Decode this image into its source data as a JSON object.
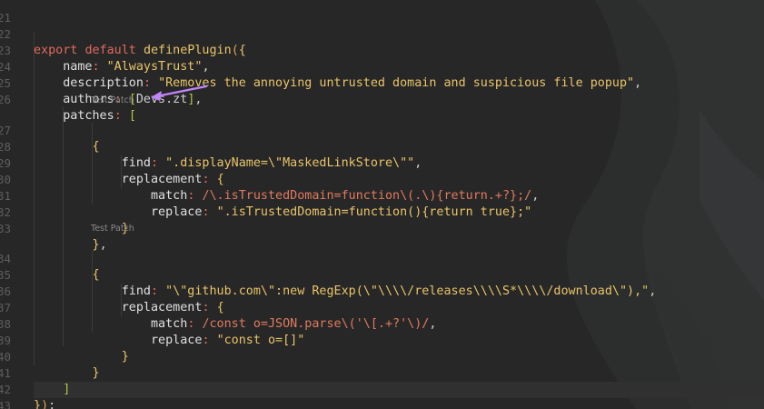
{
  "lines": [
    {
      "n": "21",
      "text": ""
    },
    {
      "n": "22",
      "text": "export default definePlugin({"
    },
    {
      "n": "23",
      "text": "    name: \"AlwaysTrust\","
    },
    {
      "n": "24",
      "text": "    description: \"Removes the annoying untrusted domain and suspicious file popup\","
    },
    {
      "n": "25",
      "text": "    authors: [Devs.zt],"
    },
    {
      "n": "26",
      "text": "    patches: ["
    },
    {
      "n": "27",
      "text": "        {"
    },
    {
      "n": "28",
      "text": "            find: \".displayName=\\\"MaskedLinkStore\\\"\","
    },
    {
      "n": "29",
      "text": "            replacement: {"
    },
    {
      "n": "30",
      "text": "                match: /\\.isTrustedDomain=function\\(.\\){return.+?};/,"
    },
    {
      "n": "31",
      "text": "                replace: \".isTrustedDomain=function(){return true};\""
    },
    {
      "n": "32",
      "text": "            }"
    },
    {
      "n": "33",
      "text": "        },"
    },
    {
      "n": "34",
      "text": "        {"
    },
    {
      "n": "35",
      "text": "            find: \"\\\"github.com\\\":new RegExp(\\\"\\\\\\\\/releases\\\\\\\\S*\\\\\\\\/download\\\"),\","
    },
    {
      "n": "36",
      "text": "            replacement: {"
    },
    {
      "n": "37",
      "text": "                match: /const o=JSON.parse\\('\\[.+?'\\)/,"
    },
    {
      "n": "38",
      "text": "                replace: \"const o=[]\""
    },
    {
      "n": "39",
      "text": "            }"
    },
    {
      "n": "40",
      "text": "        }"
    },
    {
      "n": "41",
      "text": "    ]"
    },
    {
      "n": "42",
      "text": "});"
    },
    {
      "n": "43",
      "text": ""
    }
  ],
  "codelens": {
    "patch1": "Test Patch",
    "patch2": "Test Patch"
  },
  "colors": {
    "background": "#272727",
    "keyword": "#e06a5a",
    "string": "#e9c46a",
    "property": "#e0e0e0",
    "regex": "#e07a5f",
    "annotation_arrow": "#c084fc"
  }
}
